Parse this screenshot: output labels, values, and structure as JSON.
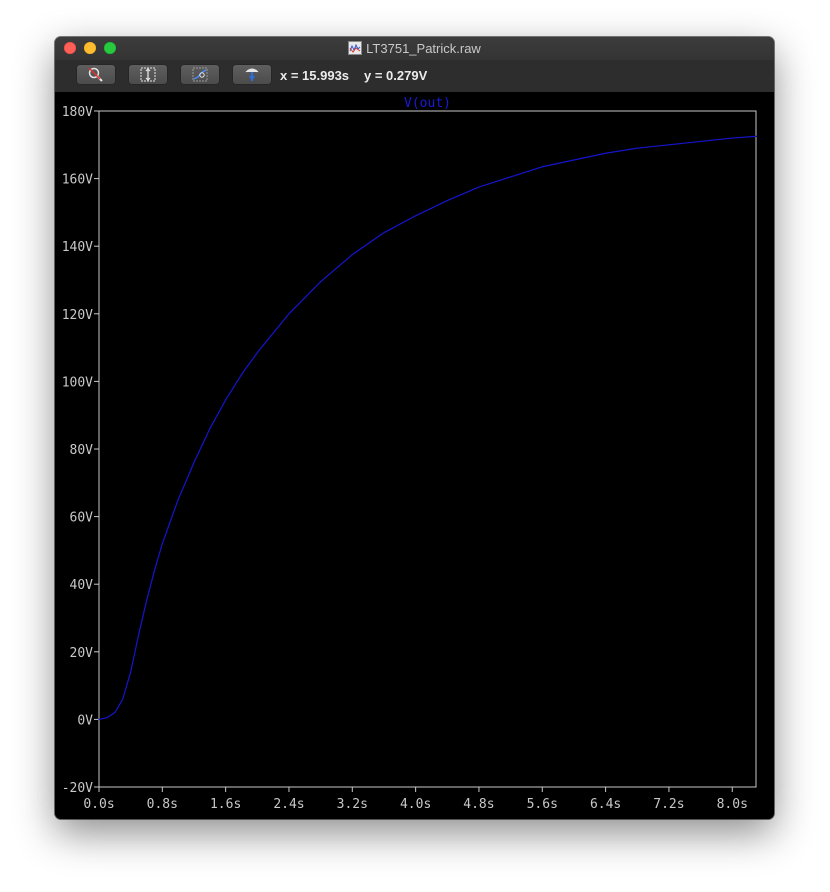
{
  "window": {
    "title": "LT3751_Patrick.raw"
  },
  "toolbar": {
    "buttons": [
      {
        "name": "zoom-out-button",
        "icon": "magnifier-cancel-icon"
      },
      {
        "name": "autorange-button",
        "icon": "autorange-icon"
      },
      {
        "name": "zoom-to-fit-button",
        "icon": "zoom-fit-icon"
      },
      {
        "name": "cursor-probe-button",
        "icon": "probe-icon"
      }
    ],
    "cursor_x": "x = 15.993s",
    "cursor_y": "y = 0.279V"
  },
  "colors": {
    "trace": "#1515d0",
    "axis": "#c8c8c8",
    "background": "#000000"
  },
  "chart_data": {
    "type": "line",
    "title": "",
    "xlabel": "",
    "ylabel": "",
    "xlim": [
      0,
      8.3
    ],
    "ylim": [
      -20,
      180
    ],
    "x_ticks": [
      0.0,
      0.8,
      1.6,
      2.4,
      3.2,
      4.0,
      4.8,
      5.6,
      6.4,
      7.2,
      8.0
    ],
    "x_tick_labels": [
      "0.0s",
      "0.8s",
      "1.6s",
      "2.4s",
      "3.2s",
      "4.0s",
      "4.8s",
      "5.6s",
      "6.4s",
      "7.2s",
      "8.0s"
    ],
    "y_ticks": [
      -20,
      0,
      20,
      40,
      60,
      80,
      100,
      120,
      140,
      160,
      180
    ],
    "y_tick_labels": [
      "-20V",
      "0V",
      "20V",
      "40V",
      "60V",
      "80V",
      "100V",
      "120V",
      "140V",
      "160V",
      "180V"
    ],
    "grid": false,
    "series": [
      {
        "name": "V(out)",
        "x": [
          0.0,
          0.1,
          0.2,
          0.3,
          0.4,
          0.5,
          0.6,
          0.7,
          0.8,
          1.0,
          1.2,
          1.4,
          1.6,
          1.8,
          2.0,
          2.4,
          2.8,
          3.2,
          3.6,
          4.0,
          4.4,
          4.8,
          5.2,
          5.6,
          6.0,
          6.4,
          6.8,
          7.2,
          7.6,
          8.0,
          8.3
        ],
        "y": [
          0.0,
          0.5,
          2.0,
          6.0,
          14.0,
          25.0,
          35.0,
          44.0,
          52.0,
          65.0,
          76.0,
          86.0,
          94.5,
          102.0,
          108.5,
          120.0,
          129.5,
          137.5,
          144.0,
          149.0,
          153.5,
          157.5,
          160.5,
          163.5,
          165.5,
          167.5,
          169.0,
          170.0,
          171.0,
          172.0,
          172.5
        ]
      }
    ]
  }
}
